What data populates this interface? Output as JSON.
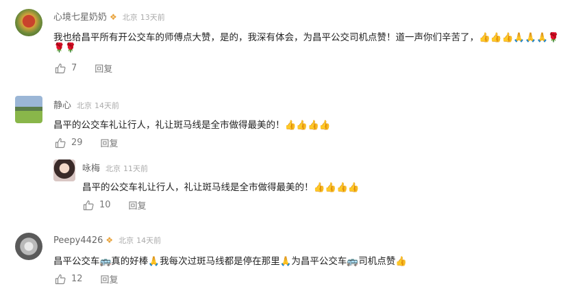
{
  "comments": [
    {
      "name": "心境七星奶奶",
      "badge": "❖",
      "location": "北京",
      "time": "13天前",
      "text_line1": "我也给昌平所有开公交车的师傅点大赞，是的，我深有体会，为昌平公交司机点赞！道一声你们辛苦了，👍👍👍🙏🙏🙏🌹",
      "text_line2": "🌹🌹",
      "likes": "7",
      "reply_label": "回复"
    },
    {
      "name": "静心",
      "location": "北京",
      "time": "14天前",
      "text": "昌平的公交车礼让行人，礼让斑马线是全市做得最美的！👍👍👍👍",
      "likes": "29",
      "reply_label": "回复",
      "reply": {
        "name": "咏梅",
        "location": "北京",
        "time": "11天前",
        "text": "昌平的公交车礼让行人，礼让斑马线是全市做得最美的！👍👍👍👍",
        "likes": "10",
        "reply_label": "回复"
      }
    },
    {
      "name": "Peepy4426",
      "badge": "❖",
      "location": "北京",
      "time": "14天前",
      "text": "昌平公交车🚌真的好棒🙏我每次过斑马线都是停在那里🙏为昌平公交车🚌司机点赞👍",
      "likes": "12",
      "reply_label": "回复"
    }
  ]
}
